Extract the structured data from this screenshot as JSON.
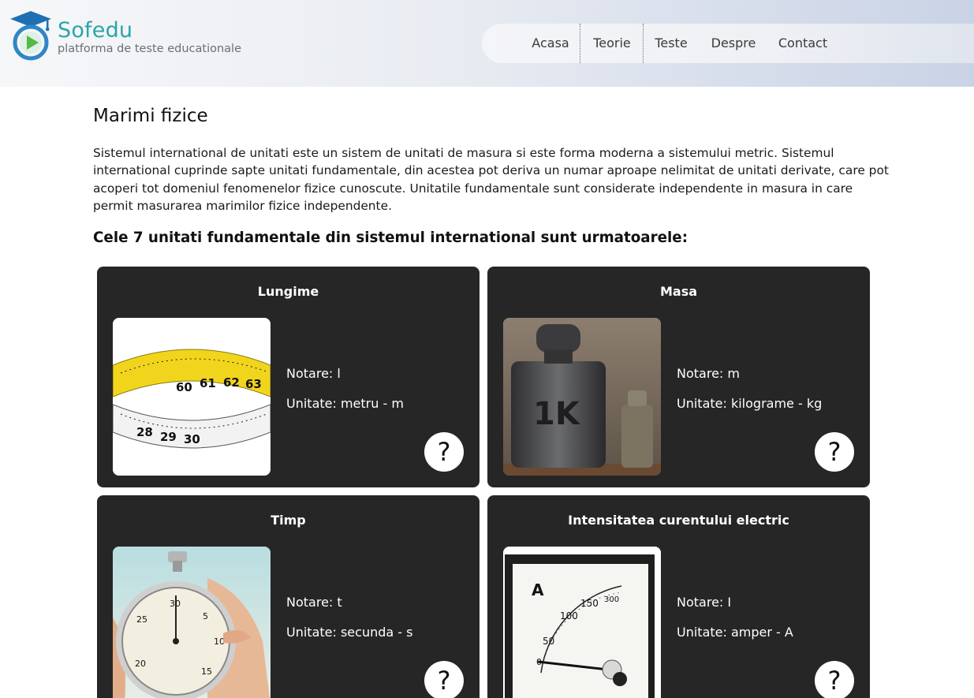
{
  "header": {
    "brand_name": "Sofedu",
    "brand_tagline": "platforma de teste educationale",
    "logo_icon": "graduation-cap-play-icon",
    "nav": [
      {
        "label": "Acasa"
      },
      {
        "label": "Teorie"
      },
      {
        "label": "Teste"
      },
      {
        "label": "Despre"
      },
      {
        "label": "Contact"
      }
    ]
  },
  "main": {
    "title": "Marimi fizice",
    "intro": "Sistemul international de unitati este un sistem de unitati de masura si este forma moderna a sistemului metric. Sistemul international cuprinde sapte unitati fundamentale, din acestea pot deriva un numar aproape nelimitat de unitati derivate, care pot acoperi tot domeniul fenomenelor fizice cunoscute. Unitatile fundamentale sunt considerate independente in masura in care permit masurarea marimilor fizice independente.",
    "subheading": "Cele 7 unitati fundamentale din sistemul international sunt urmatoarele:",
    "cards": [
      {
        "title": "Lungime",
        "notation": "Notare: l",
        "unit": "Unitate: metru - m",
        "image": "tape-measure",
        "help": "?"
      },
      {
        "title": "Masa",
        "notation": "Notare: m",
        "unit": "Unitate: kilograme - kg",
        "image": "kilogram-weight",
        "help": "?"
      },
      {
        "title": "Timp",
        "notation": "Notare: t",
        "unit": "Unitate: secunda - s",
        "image": "stopwatch",
        "help": "?"
      },
      {
        "title": "Intensitatea curentului electric",
        "notation": "Notare: I",
        "unit": "Unitate: amper - A",
        "image": "ammeter",
        "help": "?"
      }
    ]
  },
  "images": {
    "tape_numbers": [
      "60",
      "61",
      "62",
      "63",
      "28",
      "29",
      "30"
    ],
    "weight_label": "1K",
    "stopwatch_numbers": [
      "30",
      "5",
      "10",
      "15",
      "20",
      "25"
    ],
    "ammeter_letter": "A",
    "ammeter_scale": [
      "50",
      "100",
      "150",
      "300",
      "0"
    ]
  },
  "colors": {
    "brand": "#2aa5a8",
    "card_bg": "#262626",
    "tape_yellow": "#f0d51c"
  }
}
